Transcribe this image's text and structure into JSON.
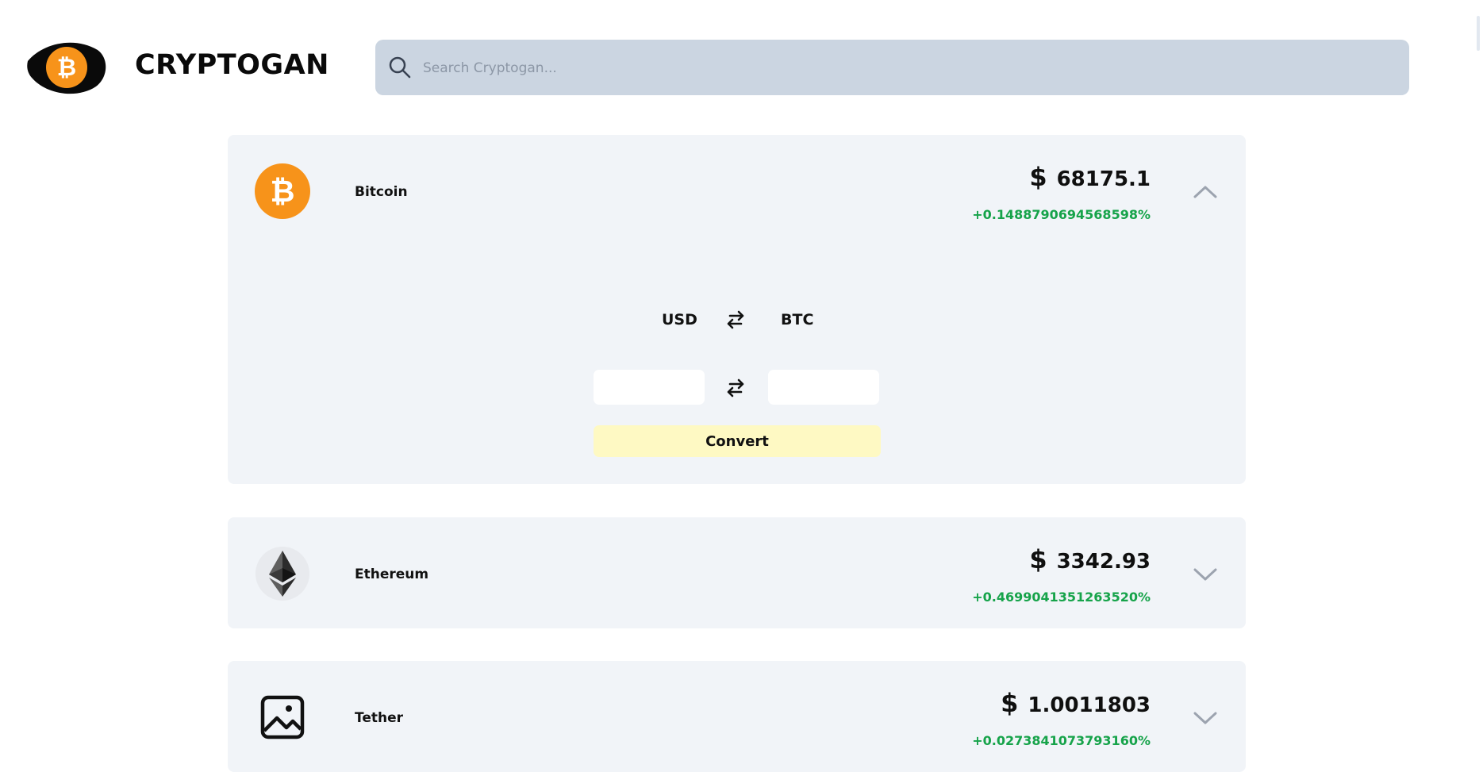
{
  "header": {
    "brand": "CRYPTOGAN",
    "search_placeholder": "Search Cryptogan..."
  },
  "coins": [
    {
      "name": "Bitcoin",
      "price": "68175.1",
      "change": "+0.1488790694568598%",
      "expanded": true,
      "icon": "bitcoin-icon",
      "converter": {
        "from": "USD",
        "to": "BTC",
        "from_value": "",
        "to_value": "",
        "button_label": "Convert"
      }
    },
    {
      "name": "Ethereum",
      "price": "3342.93",
      "change": "+0.4699041351263520%",
      "expanded": false,
      "icon": "ethereum-icon"
    },
    {
      "name": "Tether",
      "price": "1.0011803",
      "change": "+0.0273841073793160%",
      "expanded": false,
      "icon": "image-placeholder-icon"
    }
  ],
  "currency_symbol": "$",
  "colors": {
    "card_bg": "#f1f4f8",
    "search_bg": "#cbd5e1",
    "positive": "#16a34a",
    "bitcoin_orange": "#f7931a",
    "convert_button": "#fef9c3"
  }
}
